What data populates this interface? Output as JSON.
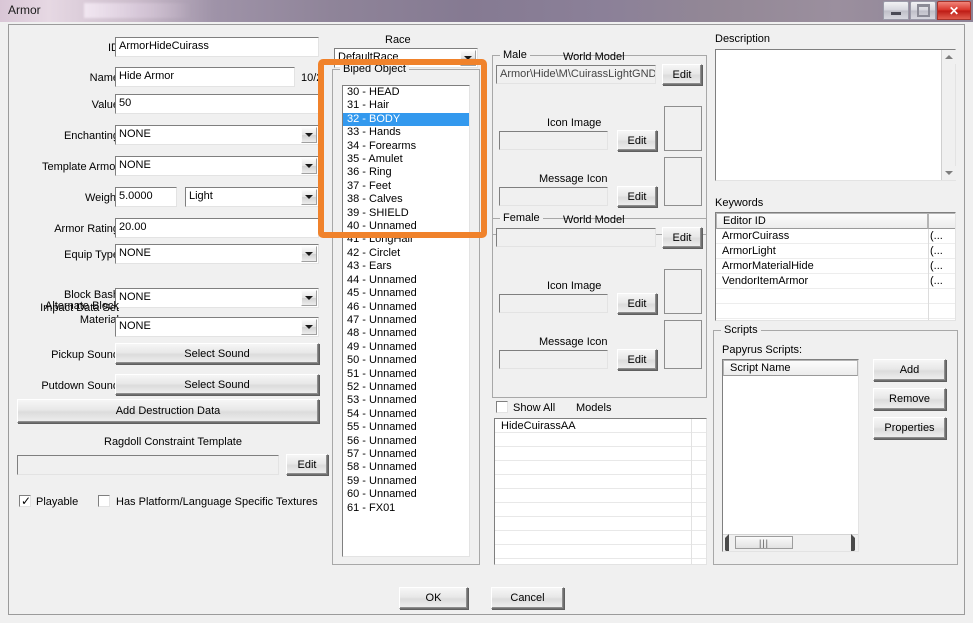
{
  "window": {
    "title": "Armor",
    "buttons": {
      "minimize": "minimize-icon",
      "maximize": "maximize-icon",
      "close": "✕"
    }
  },
  "form": {
    "id": {
      "label": "ID",
      "value": "ArmorHideCuirass"
    },
    "name": {
      "label": "Name",
      "value": "Hide Armor",
      "counter": "10/2"
    },
    "value": {
      "label": "Value",
      "value": "50"
    },
    "enchanting": {
      "label": "Enchanting",
      "value": "NONE"
    },
    "template_armor": {
      "label": "Template Armor",
      "value": "NONE"
    },
    "weight": {
      "label": "Weight",
      "value": "5.0000",
      "class_value": "Light"
    },
    "armor_rating": {
      "label": "Armor Rating",
      "value": "20.00"
    },
    "equip_type": {
      "label": "Equip Type",
      "value": "NONE"
    },
    "block_bash": {
      "label_line1": "Block Bash",
      "label_line2": "Impact Data Set",
      "value": "NONE"
    },
    "alternate_block": {
      "label_line1": "Alternate Block",
      "label_line2": "Material",
      "value": "NONE"
    },
    "pickup_sound": {
      "label": "Pickup Sound",
      "button": "Select Sound"
    },
    "putdown_sound": {
      "label": "Putdown Sound",
      "button": "Select Sound"
    },
    "add_destruction": "Add Destruction Data",
    "ragdoll": {
      "label": "Ragdoll Constraint Template",
      "value": "",
      "edit": "Edit"
    },
    "playable": {
      "label": "Playable",
      "checked": true
    },
    "platform_textures": {
      "label": "Has Platform/Language Specific Textures",
      "checked": false
    }
  },
  "race": {
    "label": "Race",
    "value": "DefaultRace"
  },
  "biped": {
    "group_title": "Biped Object",
    "items": [
      "30 - HEAD",
      "31 - Hair",
      "32 - BODY",
      "33 - Hands",
      "34 - Forearms",
      "35 - Amulet",
      "36 - Ring",
      "37 - Feet",
      "38 - Calves",
      "39 - SHIELD",
      "40 - Unnamed",
      "41 - LongHair",
      "42 - Circlet",
      "43 - Ears",
      "44 - Unnamed",
      "45 - Unnamed",
      "46 - Unnamed",
      "47 - Unnamed",
      "48 - Unnamed",
      "49 - Unnamed",
      "50 - Unnamed",
      "51 - Unnamed",
      "52 - Unnamed",
      "53 - Unnamed",
      "54 - Unnamed",
      "55 - Unnamed",
      "56 - Unnamed",
      "57 - Unnamed",
      "58 - Unnamed",
      "59 - Unnamed",
      "60 - Unnamed",
      "61 - FX01"
    ],
    "selected_index": 2
  },
  "male": {
    "group_title": "Male",
    "world_model": {
      "label": "World Model",
      "value": "Armor\\Hide\\M\\CuirassLightGND",
      "edit": "Edit"
    },
    "icon_image": {
      "label": "Icon Image",
      "value": "",
      "edit": "Edit"
    },
    "message_icon": {
      "label": "Message Icon",
      "value": "",
      "edit": "Edit"
    }
  },
  "female": {
    "group_title": "Female",
    "world_model": {
      "label": "World Model",
      "value": "",
      "edit": "Edit"
    },
    "icon_image": {
      "label": "Icon Image",
      "value": "",
      "edit": "Edit"
    },
    "message_icon": {
      "label": "Message Icon",
      "value": "",
      "edit": "Edit"
    }
  },
  "models": {
    "show_all_label": "Show All",
    "models_label": "Models",
    "show_all_checked": false,
    "rows": [
      "HideCuirassAA",
      "",
      "",
      "",
      "",
      "",
      "",
      "",
      "",
      "",
      ""
    ]
  },
  "description": {
    "label": "Description",
    "value": ""
  },
  "keywords": {
    "label": "Keywords",
    "column_editor_id": "Editor ID",
    "rows": [
      {
        "editor_id": "ArmorCuirass",
        "extra": "(..."
      },
      {
        "editor_id": "ArmorLight",
        "extra": "(..."
      },
      {
        "editor_id": "ArmorMaterialHide",
        "extra": "(..."
      },
      {
        "editor_id": "VendorItemArmor",
        "extra": "(..."
      }
    ]
  },
  "scripts": {
    "group_title": "Scripts",
    "papyrus_label": "Papyrus Scripts:",
    "column_script_name": "Script Name",
    "rows": [],
    "add": "Add",
    "remove": "Remove",
    "properties": "Properties"
  },
  "footer": {
    "ok": "OK",
    "cancel": "Cancel"
  },
  "annotation": {
    "color": "#f0822b"
  }
}
